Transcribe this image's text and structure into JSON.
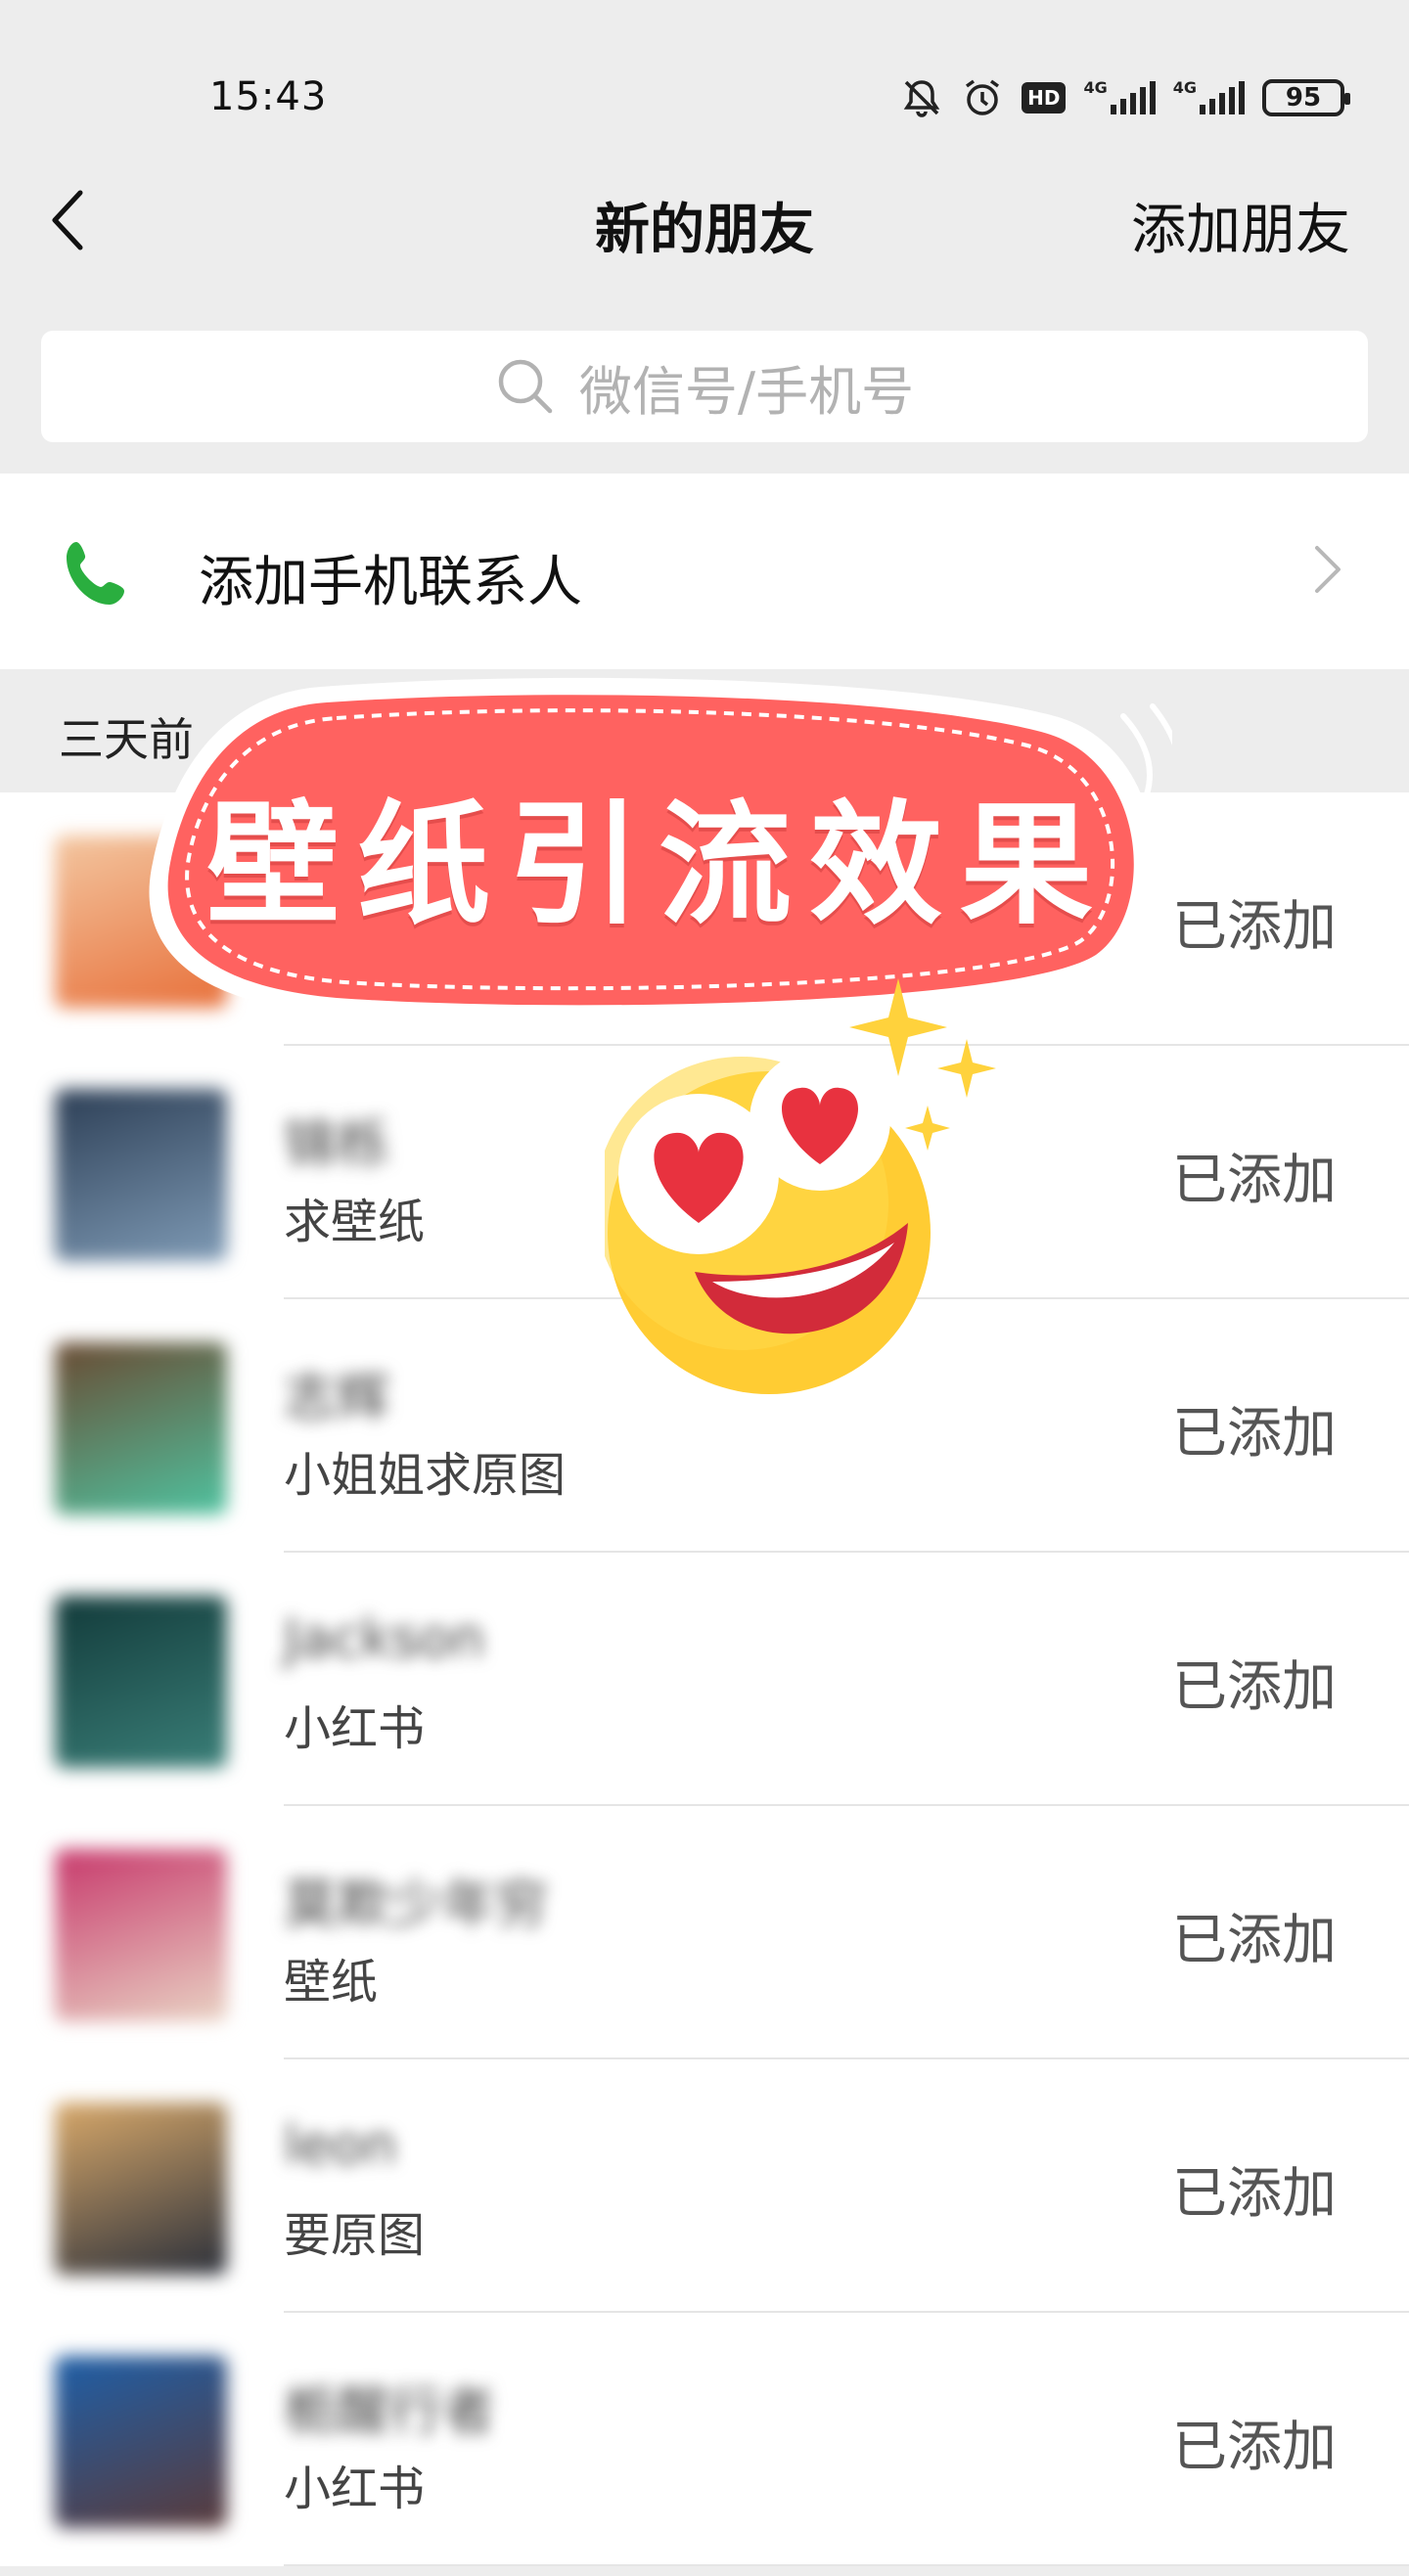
{
  "status_bar": {
    "time": "15:43",
    "icons": [
      "mute-bell-icon",
      "alarm-icon",
      "hd-icon",
      "signal-4g-icon",
      "signal-4g-icon",
      "battery-icon"
    ],
    "hd_label": "HD",
    "network_label": "4G",
    "battery": "95"
  },
  "nav": {
    "title": "新的朋友",
    "action": "添加朋友"
  },
  "search": {
    "placeholder": "微信号/手机号"
  },
  "phone_contacts": {
    "label": "添加手机联系人"
  },
  "section": {
    "label": "三天前"
  },
  "overlay": {
    "banner_text": "壁纸引流效果"
  },
  "friends": [
    {
      "name": "",
      "note": "",
      "status": "已添加",
      "avatar_colors": [
        "#f3c6a0",
        "#e8703a"
      ]
    },
    {
      "name": "锦栎",
      "note": "求壁纸",
      "status": "已添加",
      "avatar_colors": [
        "#2c3e55",
        "#7f9bb6"
      ]
    },
    {
      "name": "志辉",
      "note": "小姐姐求原图",
      "status": "已添加",
      "avatar_colors": [
        "#6a4a32",
        "#4fc3a0"
      ]
    },
    {
      "name": "Jackson",
      "note": "小红书",
      "status": "已添加",
      "avatar_colors": [
        "#123a3a",
        "#3a7f78"
      ]
    },
    {
      "name": "莫欺少年穷",
      "note": "壁纸",
      "status": "已添加",
      "avatar_colors": [
        "#c7386b",
        "#e9d3c4"
      ]
    },
    {
      "name": "leon",
      "note": "要原图",
      "status": "已添加",
      "avatar_colors": [
        "#d9a96a",
        "#2a2f3a"
      ]
    },
    {
      "name": "栀醒行者",
      "note": "小红书",
      "status": "已添加",
      "avatar_colors": [
        "#1e5fa8",
        "#5a3a3a"
      ]
    }
  ],
  "colors": {
    "background": "#ededed",
    "phone_icon": "#2aae3f",
    "banner": "#ff6260",
    "emoji_face": "#ffcc33"
  }
}
